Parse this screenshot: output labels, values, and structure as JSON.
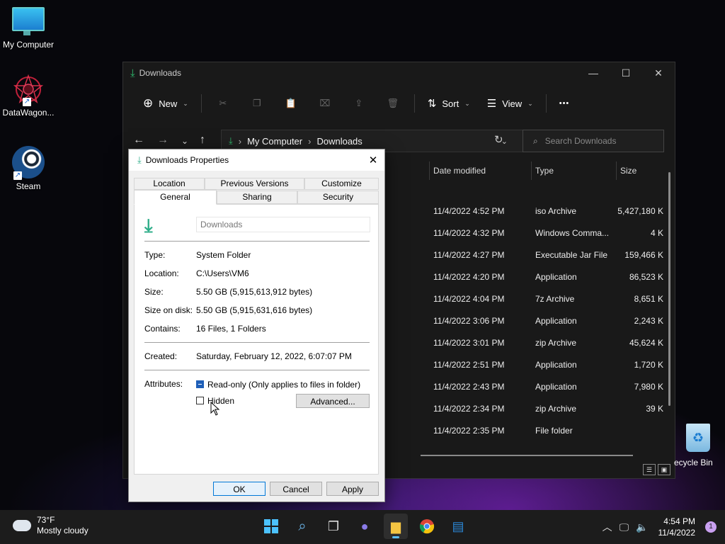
{
  "desktop": {
    "icons": [
      {
        "label": "My Computer"
      },
      {
        "label": "DataWagon..."
      },
      {
        "label": "Steam"
      }
    ],
    "recycle_bin": "ecycle Bin"
  },
  "explorer": {
    "title": "Downloads",
    "toolbar": {
      "new": "New",
      "sort": "Sort",
      "view": "View",
      "more": "•••"
    },
    "breadcrumb": [
      "My Computer",
      "Downloads"
    ],
    "search_placeholder": "Search Downloads",
    "columns": {
      "date": "Date modified",
      "type": "Type",
      "size": "Size"
    },
    "rows": [
      {
        "date": "11/4/2022 4:52 PM",
        "type": "iso Archive",
        "size": "5,427,180 K"
      },
      {
        "date": "11/4/2022 4:32 PM",
        "type": "Windows Comma...",
        "size": "4 K"
      },
      {
        "date": "11/4/2022 4:27 PM",
        "type": "Executable Jar File",
        "size": "159,466 K"
      },
      {
        "date": "11/4/2022 4:20 PM",
        "type": "Application",
        "size": "86,523 K"
      },
      {
        "date": "11/4/2022 4:04 PM",
        "type": "7z Archive",
        "size": "8,651 K"
      },
      {
        "date": "11/4/2022 3:06 PM",
        "type": "Application",
        "size": "2,243 K"
      },
      {
        "date": "11/4/2022 3:01 PM",
        "type": "zip Archive",
        "size": "45,624 K"
      },
      {
        "date": "11/4/2022 2:51 PM",
        "type": "Application",
        "size": "1,720 K"
      },
      {
        "date": "11/4/2022 2:43 PM",
        "type": "Application",
        "size": "7,980 K"
      },
      {
        "date": "11/4/2022 2:34 PM",
        "type": "zip Archive",
        "size": "39 K"
      },
      {
        "date": "11/4/2022 2:35 PM",
        "type": "File folder",
        "size": ""
      }
    ]
  },
  "dialog": {
    "title": "Downloads Properties",
    "tabs_top": [
      "Location",
      "Previous Versions",
      "Customize"
    ],
    "tabs_bottom": [
      "General",
      "Sharing",
      "Security"
    ],
    "name": "Downloads",
    "props": [
      {
        "label": "Type:",
        "value": "System Folder"
      },
      {
        "label": "Location:",
        "value": "C:\\Users\\VM6"
      },
      {
        "label": "Size:",
        "value": "5.50 GB (5,915,613,912 bytes)"
      },
      {
        "label": "Size on disk:",
        "value": "5.50 GB (5,915,631,616 bytes)"
      },
      {
        "label": "Contains:",
        "value": "16 Files, 1 Folders"
      }
    ],
    "created_label": "Created:",
    "created_value": "Saturday, February 12, 2022, 6:07:07 PM",
    "attributes_label": "Attributes:",
    "readonly_label": "Read-only (Only applies to files in folder)",
    "hidden_label": "Hidden",
    "advanced_btn": "Advanced...",
    "ok_btn": "OK",
    "cancel_btn": "Cancel",
    "apply_btn": "Apply"
  },
  "taskbar": {
    "temp": "73°F",
    "weather": "Mostly cloudy",
    "time": "4:54 PM",
    "date": "11/4/2022",
    "notifications": "1"
  }
}
